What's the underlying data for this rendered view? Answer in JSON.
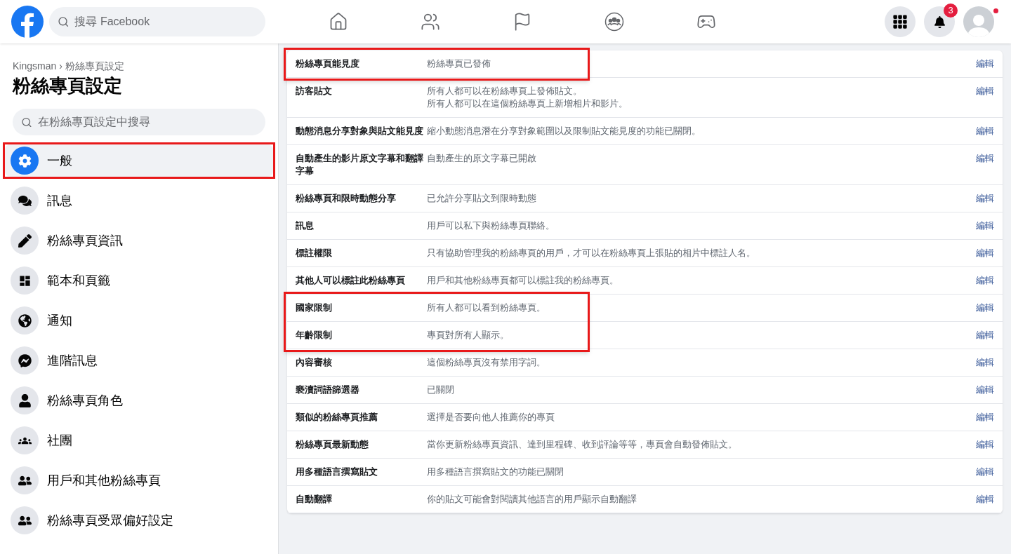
{
  "topbar": {
    "search_placeholder": "搜尋 Facebook",
    "nav": [
      {
        "selected": false
      },
      {
        "selected": false
      },
      {
        "selected": false
      },
      {
        "selected": false
      },
      {
        "selected": false
      }
    ],
    "notification_badge": "3",
    "avatar_dot": true
  },
  "sidebar": {
    "breadcrumb": [
      "Kingsman",
      "粉絲專頁設定"
    ],
    "breadcrumb_separator": "›",
    "title": "粉絲專頁設定",
    "search_placeholder": "在粉絲專頁設定中搜尋",
    "items": [
      {
        "label": "一般",
        "selected": true,
        "highlighted": true
      },
      {
        "label": "訊息",
        "selected": false,
        "highlighted": false
      },
      {
        "label": "粉絲專頁資訊",
        "selected": false,
        "highlighted": false
      },
      {
        "label": "範本和頁籤",
        "selected": false,
        "highlighted": false
      },
      {
        "label": "通知",
        "selected": false,
        "highlighted": false
      },
      {
        "label": "進階訊息",
        "selected": false,
        "highlighted": false
      },
      {
        "label": "粉絲專頁角色",
        "selected": false,
        "highlighted": false
      },
      {
        "label": "社團",
        "selected": false,
        "highlighted": false
      },
      {
        "label": "用戶和其他粉絲專頁",
        "selected": false,
        "highlighted": false
      },
      {
        "label": "粉絲專頁受眾偏好設定",
        "selected": false,
        "highlighted": false
      }
    ]
  },
  "settings": {
    "rows": [
      {
        "name": "粉絲專頁能見度",
        "value": [
          "粉絲專頁已發佈"
        ],
        "action": "編輯",
        "highlighted": true
      },
      {
        "name": "訪客貼文",
        "value": [
          "所有人都可以在粉絲專頁上發佈貼文。",
          "所有人都可以在這個粉絲專頁上新增相片和影片。"
        ],
        "action": "編輯",
        "highlighted": false
      },
      {
        "name": "動態消息分享對象與貼文能見度",
        "value": [
          "縮小動態消息潛在分享對象範圍以及限制貼文能見度的功能已關閉。"
        ],
        "action": "編輯",
        "highlighted": false
      },
      {
        "name": "自動產生的影片原文字幕和翻譯字幕",
        "value": [
          "自動產生的原文字幕已開啟"
        ],
        "action": "編輯",
        "highlighted": false
      },
      {
        "name": "粉絲專頁和限時動態分享",
        "value": [
          "已允許分享貼文到限時動態"
        ],
        "action": "編輯",
        "highlighted": false
      },
      {
        "name": "訊息",
        "value": [
          "用戶可以私下與粉絲專頁聯絡。"
        ],
        "action": "編輯",
        "highlighted": false
      },
      {
        "name": "標註權限",
        "value": [
          "只有協助管理我的粉絲專頁的用戶，才可以在粉絲專頁上張貼的相片中標註人名。"
        ],
        "action": "編輯",
        "highlighted": false
      },
      {
        "name": "其他人可以標註此粉絲專頁",
        "value": [
          "用戶和其他粉絲專頁都可以標註我的粉絲專頁。"
        ],
        "action": "編輯",
        "highlighted": false
      },
      {
        "name": "國家限制",
        "value": [
          "所有人都可以看到粉絲專頁。"
        ],
        "action": "編輯",
        "highlighted": true
      },
      {
        "name": "年齡限制",
        "value": [
          "專頁對所有人顯示。"
        ],
        "action": "編輯",
        "highlighted": true
      },
      {
        "name": "內容審核",
        "value": [
          "這個粉絲專頁沒有禁用字詞。"
        ],
        "action": "編輯",
        "highlighted": false
      },
      {
        "name": "褻瀆詞語篩選器",
        "value": [
          "已關閉"
        ],
        "action": "編輯",
        "highlighted": false
      },
      {
        "name": "類似的粉絲專頁推薦",
        "value": [
          "選擇是否要向他人推薦你的專頁"
        ],
        "action": "編輯",
        "highlighted": false
      },
      {
        "name": "粉絲專頁最新動態",
        "value": [
          "當你更新粉絲專頁資訊、達到里程碑、收到評論等等，專頁會自動發佈貼文。"
        ],
        "action": "編輯",
        "highlighted": false
      },
      {
        "name": "用多種語言撰寫貼文",
        "value": [
          "用多種語言撰寫貼文的功能已關閉"
        ],
        "action": "編輯",
        "highlighted": false
      },
      {
        "name": "自動翻譯",
        "value": [
          "你的貼文可能會對閱讀其他語言的用戶顯示自動翻譯"
        ],
        "action": "編輯",
        "highlighted": false
      }
    ]
  }
}
